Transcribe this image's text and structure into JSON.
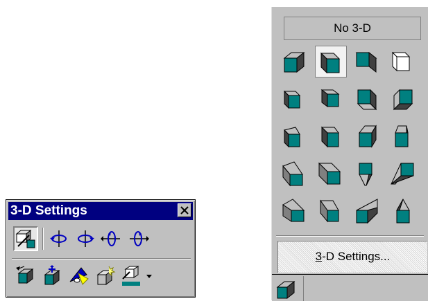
{
  "toolbar": {
    "title": "3-D Settings",
    "close_icon": "close-icon",
    "row1": [
      {
        "name": "3d-on-off-toggle",
        "icon": "3d-toggle-icon"
      },
      {
        "name": "tilt-down-button",
        "icon": "tilt-down-icon"
      },
      {
        "name": "tilt-up-button",
        "icon": "tilt-up-icon"
      },
      {
        "name": "tilt-left-button",
        "icon": "tilt-left-icon"
      },
      {
        "name": "tilt-right-button",
        "icon": "tilt-right-icon"
      }
    ],
    "row2": [
      {
        "name": "depth-button",
        "icon": "depth-icon"
      },
      {
        "name": "direction-button",
        "icon": "direction-icon"
      },
      {
        "name": "lighting-button",
        "icon": "lighting-icon"
      },
      {
        "name": "surface-button",
        "icon": "surface-icon"
      },
      {
        "name": "3d-color-button",
        "icon": "3d-color-icon",
        "color": "#008080"
      }
    ]
  },
  "palette": {
    "no_3d_label": "No 3-D",
    "settings_prefix": "3",
    "settings_rest": "-D Settings...",
    "styles_count": 20,
    "selected_style": 2,
    "colors": {
      "face": "#008080",
      "side": "#808080",
      "light": "#c0c0c0",
      "dark": "#404040",
      "background": "#c0c0c0"
    }
  }
}
